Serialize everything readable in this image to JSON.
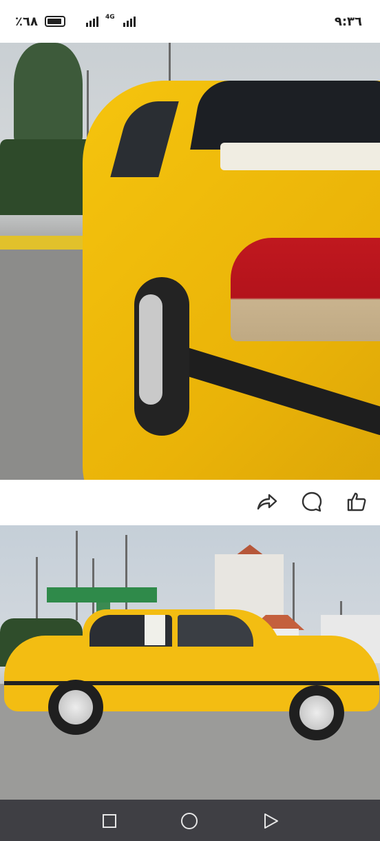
{
  "status_bar": {
    "time": "٩:٣٦",
    "battery_percent": "٪٦٨",
    "network_type": "4G"
  },
  "photos": [
    {
      "subject": "yellow-sedan-rear"
    },
    {
      "subject": "yellow-sedan-side"
    }
  ],
  "actions": {
    "share_icon": "share-icon",
    "comment_icon": "comment-icon",
    "like_icon": "like-icon"
  },
  "nav": {
    "recents_icon": "square-icon",
    "home_icon": "circle-icon",
    "back_icon": "triangle-icon"
  },
  "colors": {
    "status_bar_bg": "#ffffff",
    "nav_bar_bg": "#3f3f44",
    "car_yellow": "#f3bd12"
  }
}
